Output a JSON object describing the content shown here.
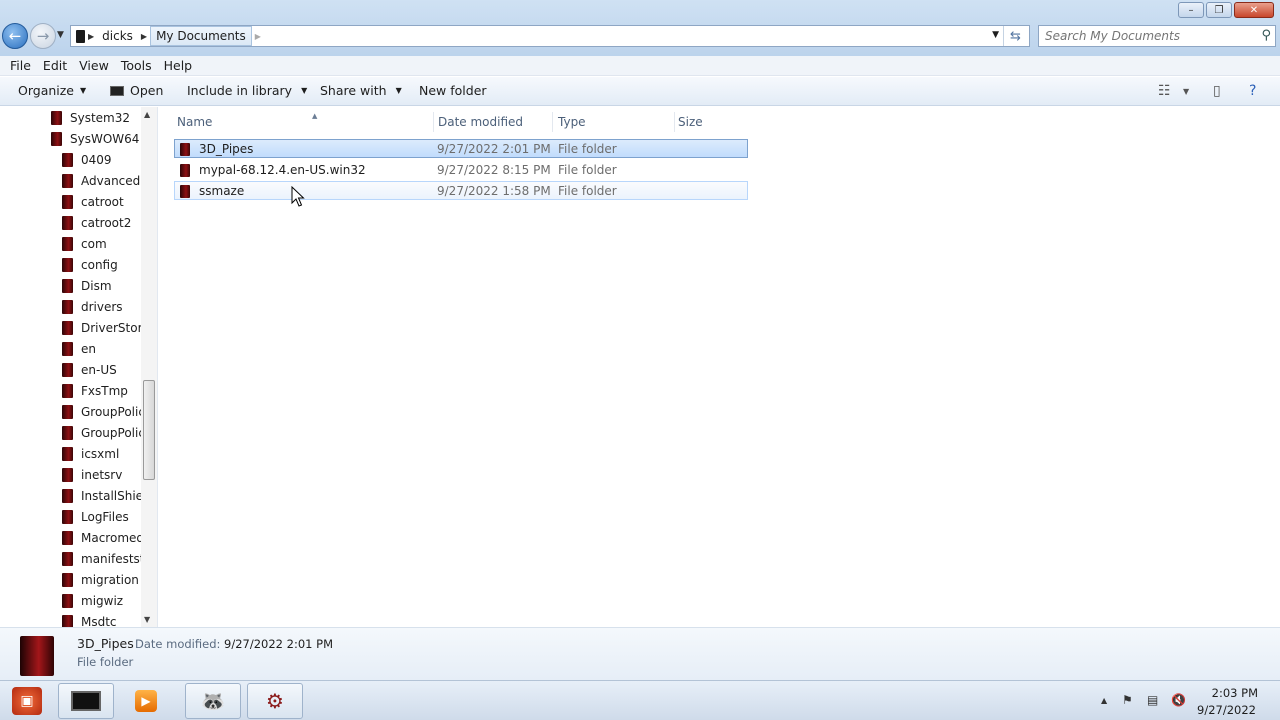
{
  "window": {
    "minimize_glyph": "–",
    "maximize_glyph": "❐",
    "close_glyph": "✕"
  },
  "address": {
    "crumbs": [
      "dicks",
      "My Documents"
    ]
  },
  "search": {
    "placeholder": "Search My Documents"
  },
  "menu": [
    "File",
    "Edit",
    "View",
    "Tools",
    "Help"
  ],
  "toolbar": {
    "organize": "Organize",
    "open": "Open",
    "include_in_library": "Include in library",
    "share_with": "Share with",
    "new_folder": "New folder"
  },
  "nav": {
    "items": [
      "System32",
      "SysWOW64",
      "0409",
      "AdvancedIn",
      "catroot",
      "catroot2",
      "com",
      "config",
      "Dism",
      "drivers",
      "DriverStore",
      "en",
      "en-US",
      "FxsTmp",
      "GroupPolic",
      "GroupPolic",
      "icsxml",
      "inetsrv",
      "InstallShiel",
      "LogFiles",
      "Macromed",
      "manifeststc",
      "migration",
      "migwiz",
      "Msdtc"
    ]
  },
  "columns": {
    "name": "Name",
    "date": "Date modified",
    "type": "Type",
    "size": "Size"
  },
  "files": [
    {
      "name": "3D_Pipes",
      "date": "9/27/2022 2:01 PM",
      "type": "File folder",
      "state": "selected"
    },
    {
      "name": "mypal-68.12.4.en-US.win32",
      "date": "9/27/2022 8:15 PM",
      "type": "File folder",
      "state": "normal"
    },
    {
      "name": "ssmaze",
      "date": "9/27/2022 1:58 PM",
      "type": "File folder",
      "state": "hover"
    }
  ],
  "details": {
    "name": "3D_Pipes",
    "date_label": "Date modified:",
    "date_value": "9/27/2022 2:01 PM",
    "type": "File folder"
  },
  "taskbar": {
    "time": "2:03 PM",
    "date": "9/27/2022"
  }
}
